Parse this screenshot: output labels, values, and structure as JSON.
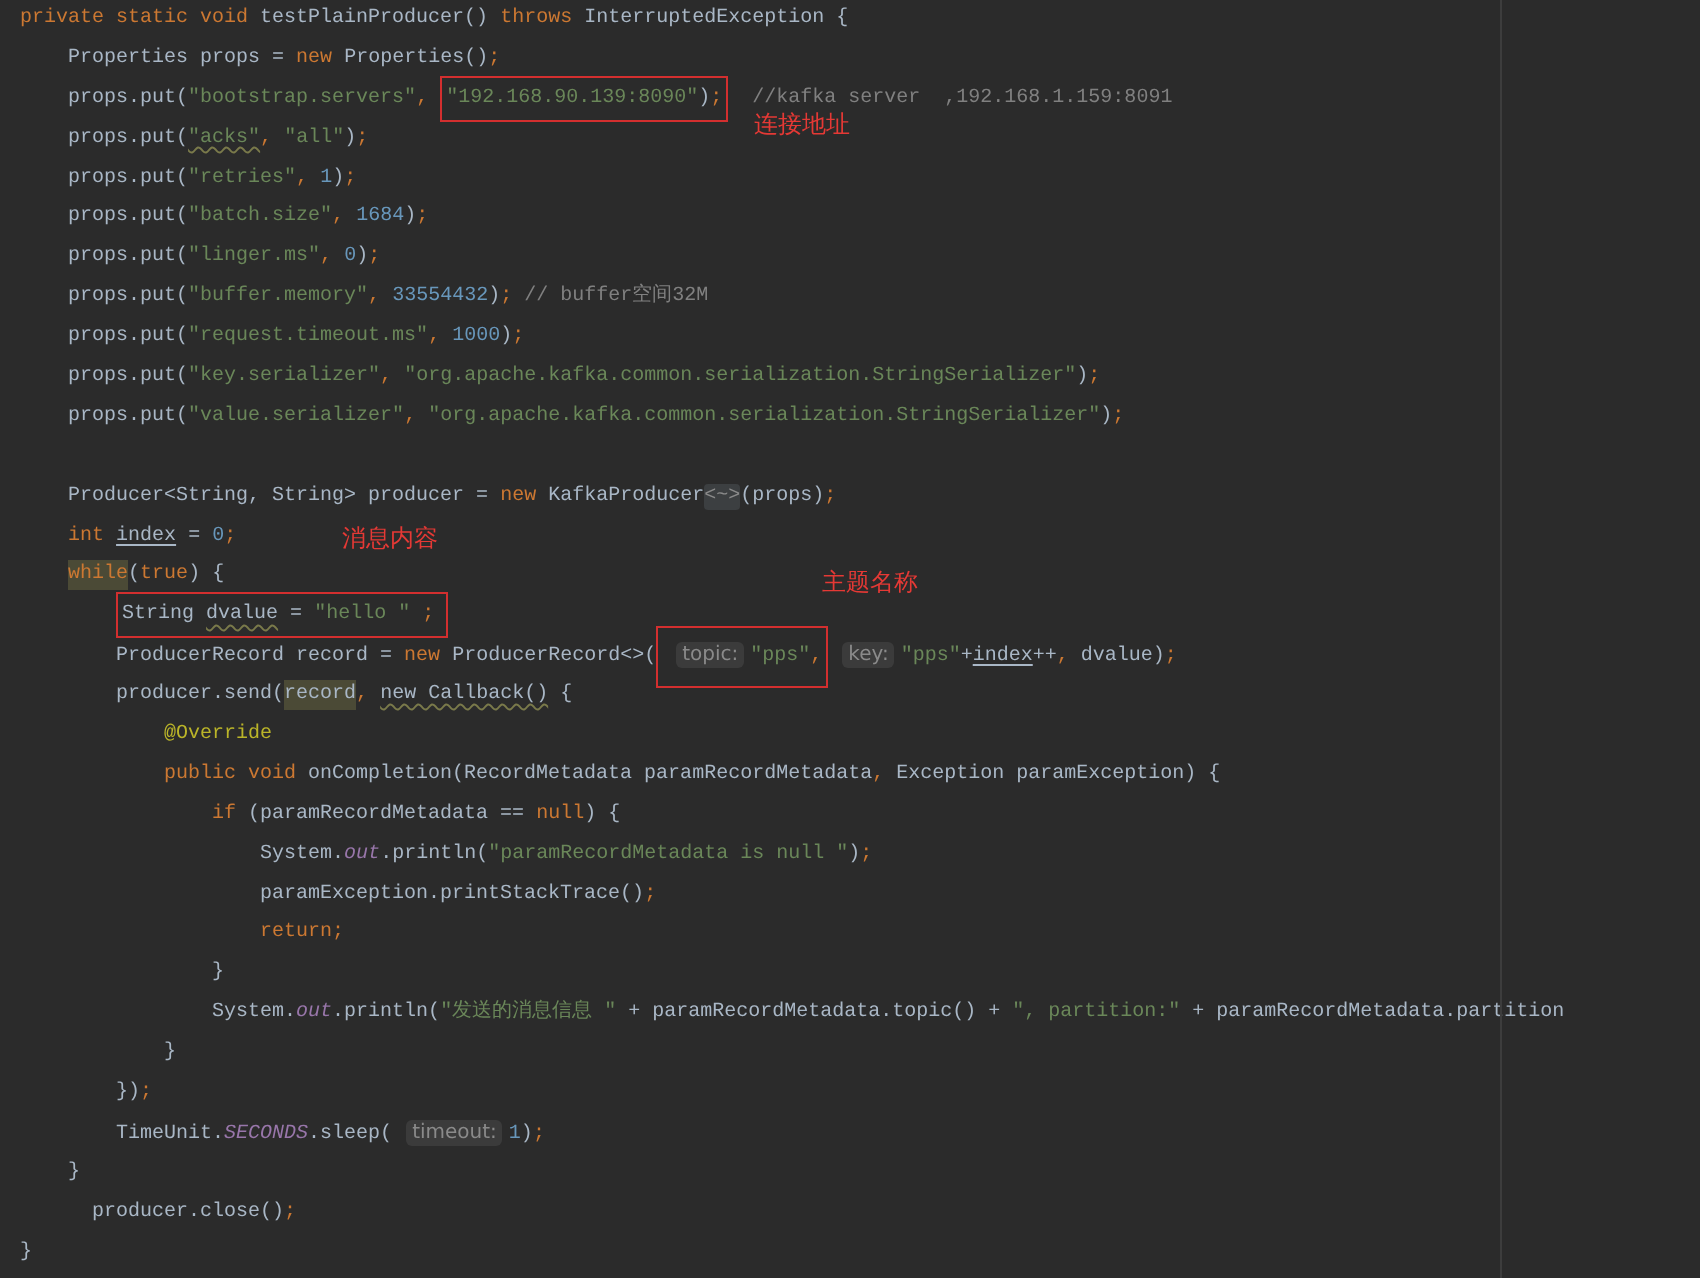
{
  "editor": {
    "lines": [
      {
        "kind": "code",
        "tokens": [
          {
            "kind": "keyword",
            "text": "private static void "
          },
          {
            "kind": "plain",
            "text": "testPlainProducer() "
          },
          {
            "kind": "keyword",
            "text": "throws "
          },
          {
            "kind": "plain",
            "text": "InterruptedException {"
          }
        ]
      },
      {
        "kind": "code",
        "tokens": [
          {
            "kind": "plain",
            "text": "    Properties props = "
          },
          {
            "kind": "keyword",
            "text": "new "
          },
          {
            "kind": "plain",
            "text": "Properties()"
          },
          {
            "kind": "punct",
            "text": ";"
          }
        ]
      },
      {
        "kind": "code",
        "tokens": [
          {
            "kind": "plain",
            "text": "    props.put("
          },
          {
            "kind": "string",
            "text": "\"bootstrap.servers\""
          },
          {
            "kind": "punct",
            "text": ", "
          },
          {
            "kind": "frame",
            "note": "连接地址",
            "children": [
              {
                "kind": "string",
                "text": "\"192.168.90.139:8090\""
              },
              {
                "kind": "plain",
                "text": ")"
              },
              {
                "kind": "punct",
                "text": ";"
              }
            ]
          },
          {
            "kind": "comment",
            "text": "  //kafka server  ,192.168.1.159:8091"
          }
        ]
      },
      {
        "kind": "code",
        "tokens": [
          {
            "kind": "plain",
            "text": "    props.put("
          },
          {
            "kind": "string",
            "text": "\"acks\"",
            "wavy": true
          },
          {
            "kind": "punct",
            "text": ", "
          },
          {
            "kind": "string",
            "text": "\"all\""
          },
          {
            "kind": "plain",
            "text": ")"
          },
          {
            "kind": "punct",
            "text": ";"
          }
        ]
      },
      {
        "kind": "code",
        "tokens": [
          {
            "kind": "plain",
            "text": "    props.put("
          },
          {
            "kind": "string",
            "text": "\"retries\""
          },
          {
            "kind": "punct",
            "text": ", "
          },
          {
            "kind": "number",
            "text": "1"
          },
          {
            "kind": "plain",
            "text": ")"
          },
          {
            "kind": "punct",
            "text": ";"
          }
        ]
      },
      {
        "kind": "code",
        "tokens": [
          {
            "kind": "plain",
            "text": "    props.put("
          },
          {
            "kind": "string",
            "text": "\"batch.size\""
          },
          {
            "kind": "punct",
            "text": ", "
          },
          {
            "kind": "number",
            "text": "1684"
          },
          {
            "kind": "plain",
            "text": ")"
          },
          {
            "kind": "punct",
            "text": ";"
          }
        ]
      },
      {
        "kind": "code",
        "tokens": [
          {
            "kind": "plain",
            "text": "    props.put("
          },
          {
            "kind": "string",
            "text": "\"linger.ms\""
          },
          {
            "kind": "punct",
            "text": ", "
          },
          {
            "kind": "number",
            "text": "0"
          },
          {
            "kind": "plain",
            "text": ")"
          },
          {
            "kind": "punct",
            "text": ";"
          }
        ]
      },
      {
        "kind": "code",
        "tokens": [
          {
            "kind": "plain",
            "text": "    props.put("
          },
          {
            "kind": "string",
            "text": "\"buffer.memory\""
          },
          {
            "kind": "punct",
            "text": ", "
          },
          {
            "kind": "number",
            "text": "33554432"
          },
          {
            "kind": "plain",
            "text": ")"
          },
          {
            "kind": "punct",
            "text": ";"
          },
          {
            "kind": "comment",
            "text": " // buffer空间32M"
          }
        ]
      },
      {
        "kind": "code",
        "tokens": [
          {
            "kind": "plain",
            "text": "    props.put("
          },
          {
            "kind": "string",
            "text": "\"request.timeout.ms\""
          },
          {
            "kind": "punct",
            "text": ", "
          },
          {
            "kind": "number",
            "text": "1000"
          },
          {
            "kind": "plain",
            "text": ")"
          },
          {
            "kind": "punct",
            "text": ";"
          }
        ]
      },
      {
        "kind": "code",
        "tokens": [
          {
            "kind": "plain",
            "text": "    props.put("
          },
          {
            "kind": "string",
            "text": "\"key.serializer\""
          },
          {
            "kind": "punct",
            "text": ", "
          },
          {
            "kind": "string",
            "text": "\"org.apache.kafka.common.serialization.StringSerializer\""
          },
          {
            "kind": "plain",
            "text": ")"
          },
          {
            "kind": "punct",
            "text": ";"
          }
        ]
      },
      {
        "kind": "code",
        "tokens": [
          {
            "kind": "plain",
            "text": "    props.put("
          },
          {
            "kind": "string",
            "text": "\"value.serializer\""
          },
          {
            "kind": "punct",
            "text": ", "
          },
          {
            "kind": "string",
            "text": "\"org.apache.kafka.common.serialization.StringSerializer\""
          },
          {
            "kind": "plain",
            "text": ")"
          },
          {
            "kind": "punct",
            "text": ";"
          }
        ]
      },
      {
        "kind": "blank"
      },
      {
        "kind": "code",
        "tokens": [
          {
            "kind": "plain",
            "text": "    Producer<String, String> producer = "
          },
          {
            "kind": "keyword",
            "text": "new "
          },
          {
            "kind": "plain",
            "text": "KafkaProducer"
          },
          {
            "kind": "fold",
            "text": "<~>"
          },
          {
            "kind": "plain",
            "text": "(props)"
          },
          {
            "kind": "punct",
            "text": ";"
          }
        ]
      },
      {
        "kind": "code",
        "tokens": [
          {
            "kind": "keyword",
            "text": "    int "
          },
          {
            "kind": "plain",
            "text": "index",
            "underlined": true
          },
          {
            "kind": "plain",
            "text": " = "
          },
          {
            "kind": "number",
            "text": "0"
          },
          {
            "kind": "punct",
            "text": ";"
          }
        ]
      },
      {
        "kind": "code",
        "tokens": [
          {
            "kind": "keyword",
            "text": "    while",
            "highlighted": true
          },
          {
            "kind": "plain",
            "text": "("
          },
          {
            "kind": "keyword",
            "text": "true"
          },
          {
            "kind": "plain",
            "text": ") {"
          }
        ]
      },
      {
        "kind": "code",
        "tokens": [
          {
            "kind": "frame",
            "note": "消息内容",
            "children": [
              {
                "kind": "plain",
                "text": "        String "
              },
              {
                "kind": "plain",
                "text": "dvalue",
                "wavy": true
              },
              {
                "kind": "plain",
                "text": " = "
              },
              {
                "kind": "string",
                "text": "\"hello \""
              },
              {
                "kind": "punct",
                "text": " ;"
              }
            ]
          }
        ]
      },
      {
        "kind": "code",
        "tokens": [
          {
            "kind": "plain",
            "text": "        ProducerRecord record = "
          },
          {
            "kind": "keyword",
            "text": "new "
          },
          {
            "kind": "plain",
            "text": "ProducerRecord<>("
          },
          {
            "kind": "frame",
            "note": "主题名称",
            "children": [
              {
                "kind": "hint",
                "text": "topic:"
              },
              {
                "kind": "string",
                "text": "\"pps\""
              },
              {
                "kind": "punct",
                "text": ","
              }
            ]
          },
          {
            "kind": "hint",
            "text": "key:"
          },
          {
            "kind": "string",
            "text": "\"pps\""
          },
          {
            "kind": "plain",
            "text": "+"
          },
          {
            "kind": "plain",
            "text": "index",
            "underlined": true
          },
          {
            "kind": "plain",
            "text": "++"
          },
          {
            "kind": "punct",
            "text": ", "
          },
          {
            "kind": "plain",
            "text": "dvalue)"
          },
          {
            "kind": "punct",
            "text": ";"
          }
        ]
      },
      {
        "kind": "code",
        "tokens": [
          {
            "kind": "plain",
            "text": "        producer.send("
          },
          {
            "kind": "plain",
            "text": "record",
            "highlighted": true
          },
          {
            "kind": "punct",
            "text": ", "
          },
          {
            "kind": "plain",
            "text": "new Callback()",
            "wavy": true
          },
          {
            "kind": "plain",
            "text": " {"
          }
        ]
      },
      {
        "kind": "code",
        "tokens": [
          {
            "kind": "annotation",
            "text": "            @Override"
          }
        ]
      },
      {
        "kind": "code",
        "tokens": [
          {
            "kind": "keyword",
            "text": "            public void "
          },
          {
            "kind": "plain",
            "text": "onCompletion(RecordMetadata paramRecordMetadata"
          },
          {
            "kind": "punct",
            "text": ", "
          },
          {
            "kind": "plain",
            "text": "Exception paramException) {"
          }
        ]
      },
      {
        "kind": "code",
        "tokens": [
          {
            "kind": "keyword",
            "text": "                if "
          },
          {
            "kind": "plain",
            "text": "(paramRecordMetadata == "
          },
          {
            "kind": "keyword",
            "text": "null"
          },
          {
            "kind": "plain",
            "text": ") {"
          }
        ]
      },
      {
        "kind": "code",
        "tokens": [
          {
            "kind": "plain",
            "text": "                    System."
          },
          {
            "kind": "field",
            "text": "out"
          },
          {
            "kind": "plain",
            "text": ".println("
          },
          {
            "kind": "string",
            "text": "\"paramRecordMetadata is null \""
          },
          {
            "kind": "plain",
            "text": ")"
          },
          {
            "kind": "punct",
            "text": ";"
          }
        ]
      },
      {
        "kind": "code",
        "tokens": [
          {
            "kind": "plain",
            "text": "                    paramException.printStackTrace()"
          },
          {
            "kind": "punct",
            "text": ";"
          }
        ]
      },
      {
        "kind": "code",
        "tokens": [
          {
            "kind": "keyword",
            "text": "                    return;"
          }
        ]
      },
      {
        "kind": "code",
        "tokens": [
          {
            "kind": "plain",
            "text": "                }"
          }
        ]
      },
      {
        "kind": "code",
        "tokens": [
          {
            "kind": "plain",
            "text": "                System."
          },
          {
            "kind": "field",
            "text": "out"
          },
          {
            "kind": "plain",
            "text": ".println("
          },
          {
            "kind": "string",
            "text": "\"发送的消息信息 \""
          },
          {
            "kind": "plain",
            "text": " + paramRecordMetadata.topic() + "
          },
          {
            "kind": "string",
            "text": "\", partition:\""
          },
          {
            "kind": "plain",
            "text": " + paramRecordMetadata.partition"
          }
        ]
      },
      {
        "kind": "code",
        "tokens": [
          {
            "kind": "plain",
            "text": "            }"
          }
        ]
      },
      {
        "kind": "code",
        "tokens": [
          {
            "kind": "plain",
            "text": "        })"
          },
          {
            "kind": "punct",
            "text": ";"
          }
        ]
      },
      {
        "kind": "code",
        "tokens": [
          {
            "kind": "plain",
            "text": "        TimeUnit."
          },
          {
            "kind": "field",
            "text": "SECONDS"
          },
          {
            "kind": "plain",
            "text": ".sleep("
          },
          {
            "kind": "hint",
            "text": "timeout:"
          },
          {
            "kind": "number",
            "text": "1"
          },
          {
            "kind": "plain",
            "text": ")"
          },
          {
            "kind": "punct",
            "text": ";"
          }
        ]
      },
      {
        "kind": "code",
        "tokens": [
          {
            "kind": "plain",
            "text": "    }"
          }
        ]
      },
      {
        "kind": "code",
        "tokens": [
          {
            "kind": "plain",
            "text": "      producer.close()"
          },
          {
            "kind": "punct",
            "text": ";"
          }
        ]
      },
      {
        "kind": "code",
        "tokens": [
          {
            "kind": "plain",
            "text": "}"
          }
        ]
      }
    ]
  }
}
